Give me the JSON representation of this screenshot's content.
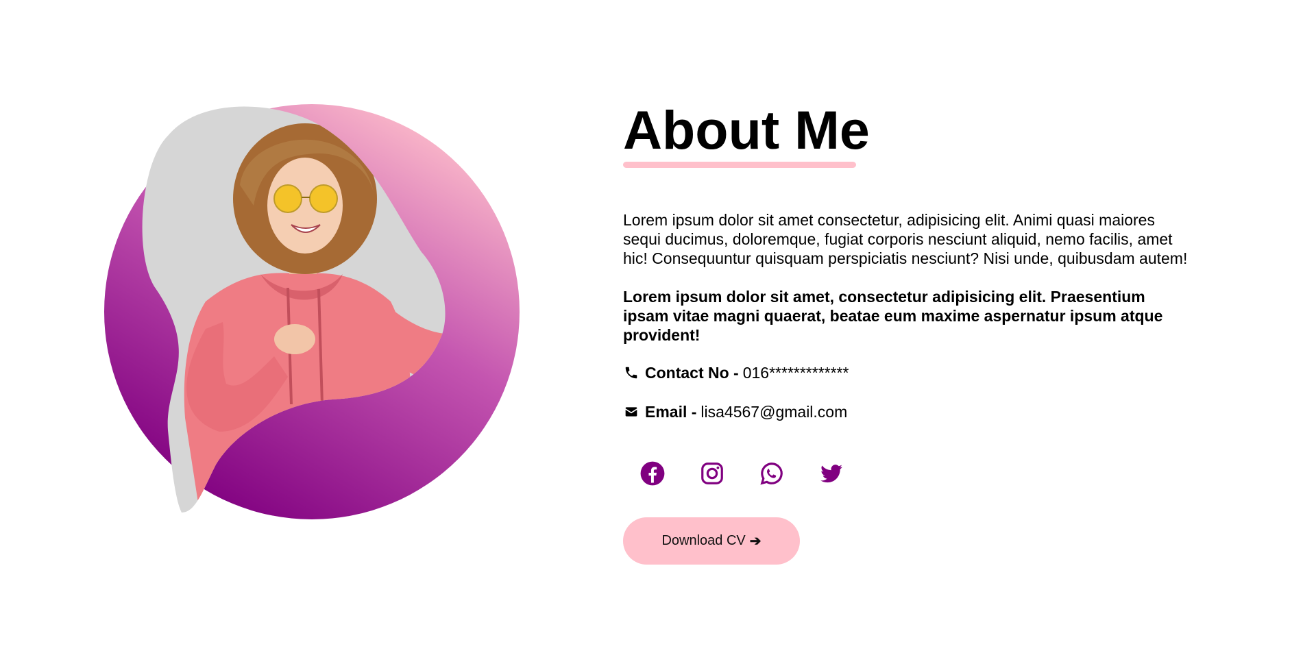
{
  "about": {
    "title": "About Me",
    "paragraph": "Lorem ipsum dolor sit amet consectetur, adipisicing elit. Animi quasi maiores sequi ducimus, doloremque, fugiat corporis nesciunt aliquid, nemo facilis, amet hic! Consequuntur quisquam perspiciatis nesciunt? Nisi unde, quibusdam autem!",
    "paragraph_bold": "Lorem ipsum dolor sit amet, consectetur adipisicing elit. Praesentium ipsam vitae magni quaerat, beatae eum maxime aspernatur ipsum atque provident!"
  },
  "contact": {
    "icon": "phone-icon",
    "label": "Contact No -",
    "value": "016*************"
  },
  "email": {
    "icon": "envelope-icon",
    "label": "Email -",
    "value": "lisa4567@gmail.com"
  },
  "socials": [
    {
      "icon": "facebook-icon"
    },
    {
      "icon": "instagram-icon"
    },
    {
      "icon": "whatsapp-icon"
    },
    {
      "icon": "twitter-icon"
    }
  ],
  "cv_button": {
    "label": "Download CV",
    "arrow": "➔"
  },
  "colors": {
    "accent_pink": "#ffc0cb",
    "accent_purple": "#800080",
    "text": "#000000",
    "photo_background": "#d6d6d6"
  }
}
